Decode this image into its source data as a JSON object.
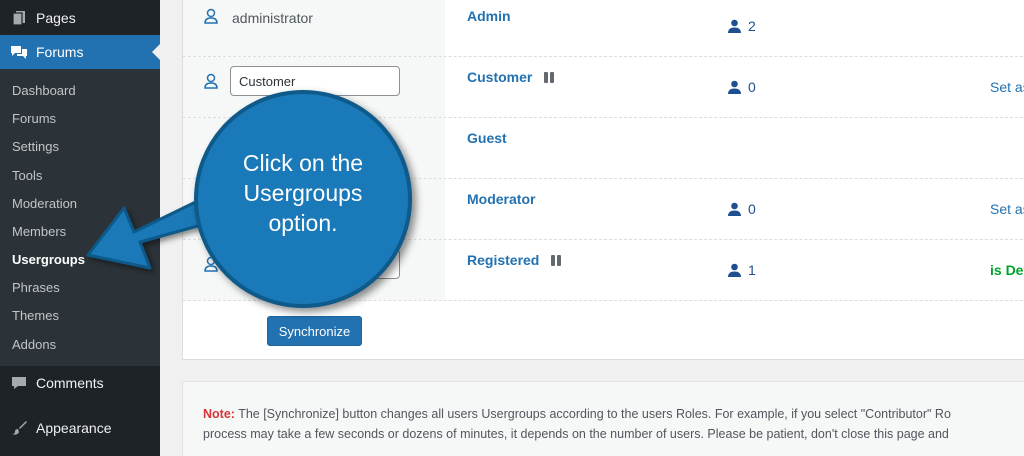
{
  "sidebar": {
    "top_items": [
      {
        "label": "Pages",
        "icon": "pages-icon"
      },
      {
        "label": "Forums",
        "icon": "forums-icon"
      },
      {
        "label": "Comments",
        "icon": "comments-icon"
      },
      {
        "label": "Appearance",
        "icon": "appearance-icon"
      }
    ],
    "submenu": [
      "Dashboard",
      "Forums",
      "Settings",
      "Tools",
      "Moderation",
      "Members",
      "Usergroups",
      "Phrases",
      "Themes",
      "Addons"
    ],
    "current_submenu": "Usergroups"
  },
  "rows": [
    {
      "role": "administrator",
      "group": "Admin",
      "paused": false,
      "count": "2",
      "action": ""
    },
    {
      "role_value": "Customer",
      "group": "Customer",
      "paused": true,
      "count": "0",
      "action": "Set as"
    },
    {
      "role_value": "",
      "group": "Guest",
      "paused": false,
      "count": "",
      "action": ""
    },
    {
      "role_value": "",
      "group": "Moderator",
      "paused": false,
      "count": "0",
      "action": "Set as"
    },
    {
      "role_value": "",
      "group": "Registered",
      "paused": true,
      "count": "1",
      "action": "is Def"
    }
  ],
  "sync_button": "Synchronize",
  "note": {
    "label": "Note:",
    "line1": " The [Synchronize] button changes all users Usergroups according to the users Roles. For example, if you select \"Contributor\" Ro",
    "line2": "process may take a few seconds or dozens of minutes, it depends on the number of users. Please be patient, don't close this page and"
  },
  "callout": {
    "line1": "Click on the",
    "line2": "Usergroups",
    "line3": "option."
  },
  "colors": {
    "sidebar_bg": "#1d2327",
    "accent": "#2271b1",
    "callout": "#1a79b8",
    "success": "#00a32a",
    "note_label": "#d63638"
  }
}
